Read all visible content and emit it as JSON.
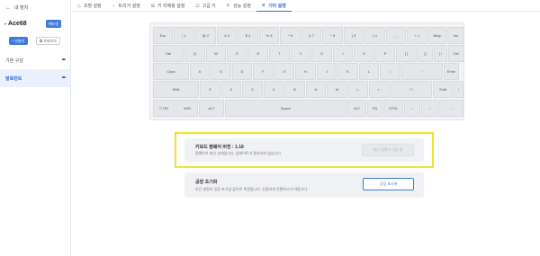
{
  "sidebar": {
    "back_label": "내 장치",
    "device_name": "Ace68",
    "badge": "메뉴얼",
    "primary_button": "+ 만들기",
    "secondary_button": "가져오기",
    "items": [
      {
        "label": "기본 구성",
        "active": false
      },
      {
        "label": "발로란트",
        "active": true
      }
    ]
  },
  "tabs": [
    {
      "icon": "lightbulb-icon",
      "glyph": "◇",
      "label": "조명 설정",
      "active": false
    },
    {
      "icon": "trigger-icon",
      "glyph": "♁",
      "label": "트리거 설정",
      "active": false
    },
    {
      "icon": "keymap-icon",
      "glyph": "⊞",
      "label": "키 리매핑 설정",
      "active": false
    },
    {
      "icon": "advanced-key-icon",
      "glyph": "⊡",
      "label": "고급 키",
      "active": false
    },
    {
      "icon": "performance-icon",
      "glyph": "⇱",
      "label": "성능 설정",
      "active": false
    },
    {
      "icon": "settings-icon",
      "glyph": "⊙",
      "label": "기타 설정",
      "active": true
    }
  ],
  "keyboard": {
    "rows": [
      [
        "Esc",
        "! 1",
        "@ 2",
        "# 3",
        "$ 4",
        "% 5",
        "^ 6",
        "& 7",
        "* 8",
        "( 9",
        ") 0",
        "_ -",
        "+ =",
        "Bksp",
        "Ins"
      ],
      [
        "Tab",
        "Q",
        "W",
        "E",
        "R",
        "T",
        "Y",
        "U",
        "I",
        "O",
        "P",
        "{ [",
        "} ]",
        "| \\",
        "Del"
      ],
      [
        "Caps",
        "A",
        "S",
        "D",
        "F",
        "G",
        "H",
        "J",
        "K",
        "L",
        ": ;",
        "\" '",
        "Enter",
        "PgUp"
      ],
      [
        "Shift",
        "Z",
        "X",
        "C",
        "V",
        "B",
        "N",
        "M",
        "< ,",
        "> .",
        "? /",
        "Shift",
        "↑",
        "PgDn"
      ],
      [
        "CTRL",
        "WIN",
        "ALT",
        "Space",
        "ALT",
        "FN",
        "CTRL",
        "←",
        "↓",
        "→"
      ]
    ]
  },
  "firmware": {
    "title": "키보드 펌웨어 버전 : 1.18",
    "desc": "펌웨어가 최신 상태입니다. 업데이트가 필요하지 않습니다.",
    "button": "최신 펌웨어 사용 중"
  },
  "reset": {
    "title": "공장 초기화",
    "desc": "모든 설정이 공장 초기값 값으로 복원됩니다. 신중하게 진행하시기 바랍니다.",
    "button": "공장 초기화"
  }
}
